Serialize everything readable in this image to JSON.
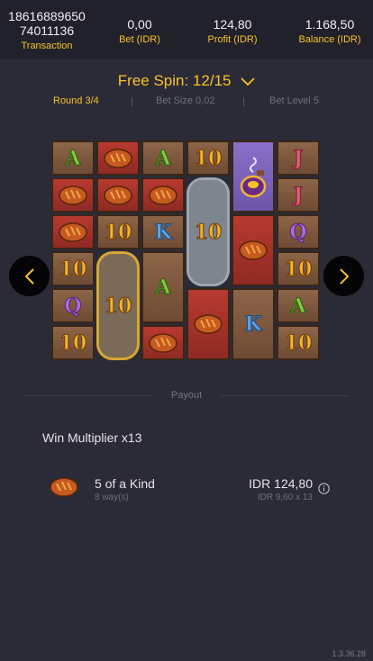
{
  "header": {
    "transaction_id_1": "18616889650",
    "transaction_id_2": "74011136",
    "transaction_label": "Transaction",
    "bet_value": "0,00",
    "bet_label": "Bet (IDR)",
    "profit_value": "124,80",
    "profit_label": "Profit (IDR)",
    "balance_value": "1.168,50",
    "balance_label": "Balance (IDR)"
  },
  "free_spin": {
    "title": "Free Spin: 12/15"
  },
  "info": {
    "round": "Round 3/4",
    "bet_size": "Bet Size 0,02",
    "bet_level": "Bet Level 5"
  },
  "reels": {
    "symbols": {
      "col1": [
        "A",
        "bread",
        "bread",
        "10",
        "Q",
        "10"
      ],
      "col2": [
        "bread",
        "bread",
        "10",
        "10 (gold wild)"
      ],
      "col3": [
        "A",
        "bread",
        "K",
        "A",
        "bread"
      ],
      "col4": [
        "10",
        "10 (steel)",
        "bread"
      ],
      "col5": [
        "potion (scatter)",
        "bread",
        "K"
      ],
      "col6": [
        "J",
        "J",
        "Q",
        "10",
        "A",
        "10"
      ]
    }
  },
  "payout": {
    "label": "Payout",
    "multiplier": "Win Multiplier x13",
    "wins": [
      {
        "icon": "bread-icon",
        "kind": "5 of a Kind",
        "ways": "8 way(s)",
        "amount": "IDR 124,80",
        "calc": "IDR 9,60 x 13"
      }
    ]
  },
  "version": "1.3.36.28",
  "colors": {
    "accent": "#f6c22a",
    "background": "#2b2b37",
    "header": "#21212b"
  }
}
